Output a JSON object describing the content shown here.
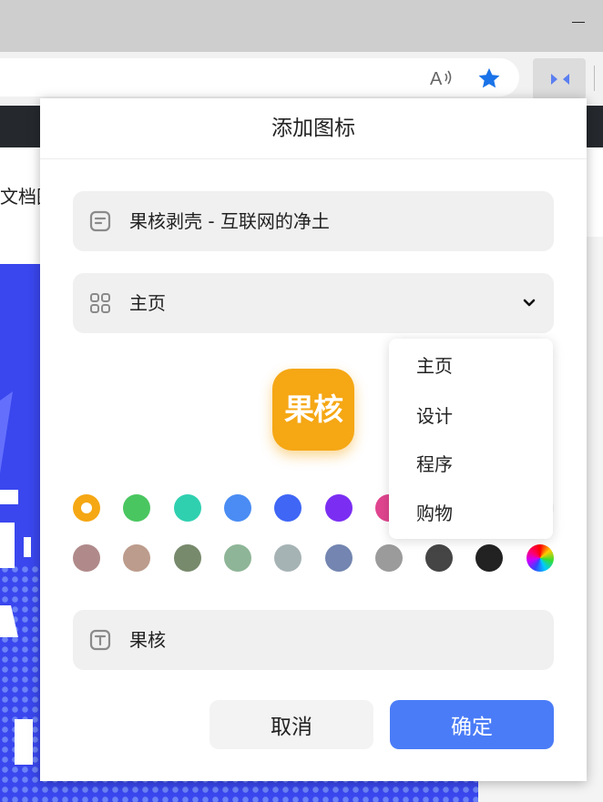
{
  "dialog": {
    "title": "添加图标",
    "site_title": "果核剥壳 - 互联网的净土",
    "category_selected": "主页",
    "icon_text": "果核",
    "preview_text": "果核",
    "preview_color": "#f5a714",
    "cancel_label": "取消",
    "confirm_label": "确定"
  },
  "dropdown": {
    "options": [
      "主页",
      "设计",
      "程序",
      "购物"
    ]
  },
  "colors": {
    "row1": [
      "#f5a714",
      "#4ac660",
      "#2fd0b0",
      "#4a8cf3",
      "#3f66f5",
      "#7b2ef2",
      "#e0458f",
      "#f0f0f0",
      "#f0f0f0",
      "#f0f0f0"
    ],
    "row2": [
      "#b08a8a",
      "#bc9c8c",
      "#778a6c",
      "#8eb597",
      "#a6b3b5",
      "#7385b0",
      "#9b9b9b",
      "#454545",
      "#222222",
      "rainbow"
    ],
    "selected_index": 0
  },
  "page": {
    "bookmark_fragment": "文档图"
  },
  "icons": {
    "read_aloud": "read-aloud-icon",
    "favorite": "star-icon",
    "extension": "extension-icon",
    "title_field": "document-icon",
    "category_field": "grid-icon",
    "dropdown_toggle": "chevron-down-icon",
    "text_field": "text-icon"
  }
}
